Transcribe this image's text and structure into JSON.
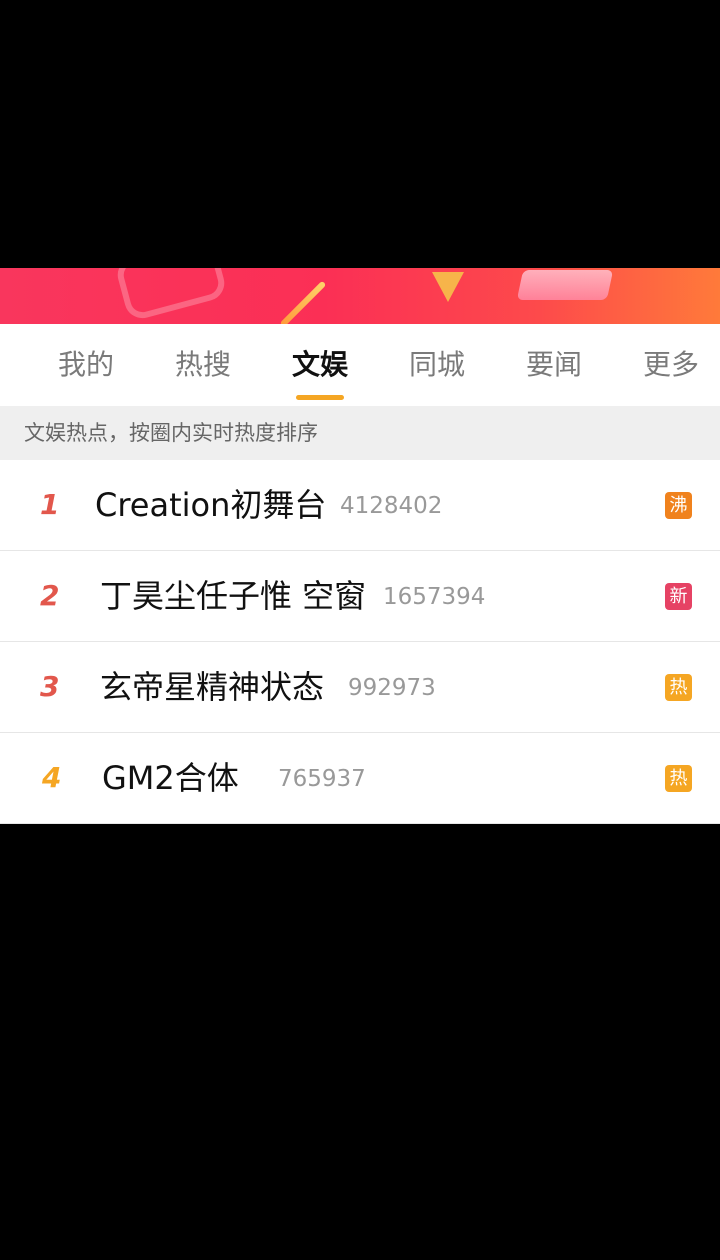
{
  "tabs": [
    {
      "label": "我的",
      "active": false
    },
    {
      "label": "热搜",
      "active": false
    },
    {
      "label": "文娱",
      "active": true
    },
    {
      "label": "同城",
      "active": false
    },
    {
      "label": "要闻",
      "active": false
    },
    {
      "label": "更多",
      "active": false
    }
  ],
  "subtitle": "文娱热点，按圈内实时热度排序",
  "colors": {
    "accent_underline": "#f5a623",
    "rank_top": "#e2574c",
    "rank_other": "#f5a623",
    "badge_boil": "#f0821d",
    "badge_new": "#e64264",
    "badge_hot": "#f5a623"
  },
  "items": [
    {
      "rank": "1",
      "topic": "Creation初舞台",
      "count": "4128402",
      "badge": "沸"
    },
    {
      "rank": "2",
      "topic": "丁昊尘任子惟 空窗",
      "count": "1657394",
      "badge": "新"
    },
    {
      "rank": "3",
      "topic": "玄帝星精神状态",
      "count": "992973",
      "badge": "热"
    },
    {
      "rank": "4",
      "topic": "GM2合体",
      "count": "765937",
      "badge": "热"
    }
  ]
}
